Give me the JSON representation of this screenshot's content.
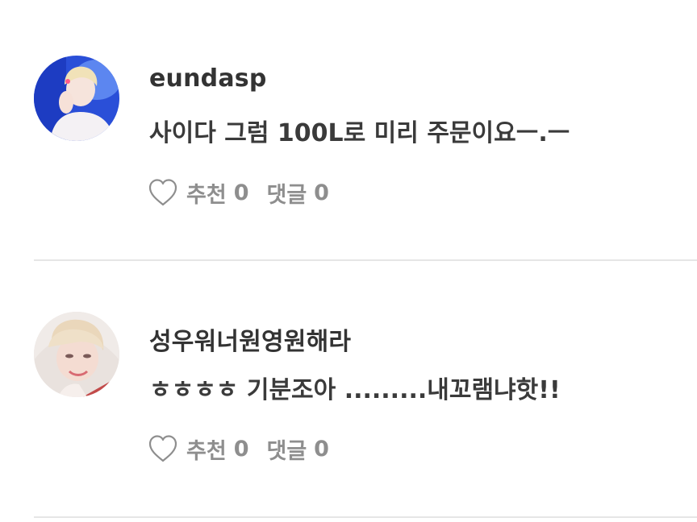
{
  "comments": [
    {
      "username": "eundasp",
      "text": "사이다 그럼 100L로 미리 주문이요ㅡ.ㅡ",
      "like_label": "추천",
      "like_count": "0",
      "reply_label": "댓글",
      "reply_count": "0",
      "avatar_icon": "user-avatar-photo",
      "avatar_colors": [
        "#2a4fd8",
        "#f3ecf0"
      ]
    },
    {
      "username": "성우워너원영원해라",
      "text": "ㅎㅎㅎㅎ 기분조아 .........내꼬램냐핫!!",
      "like_label": "추천",
      "like_count": "0",
      "reply_label": "댓글",
      "reply_count": "0",
      "avatar_icon": "user-avatar-photo",
      "avatar_colors": [
        "#e9d3c8",
        "#c24a4a"
      ]
    }
  ],
  "icons": {
    "like": "heart-outline-icon"
  },
  "colors": {
    "text": "#333333",
    "meta": "#8e8e8e",
    "divider": "#e6e6e6"
  }
}
